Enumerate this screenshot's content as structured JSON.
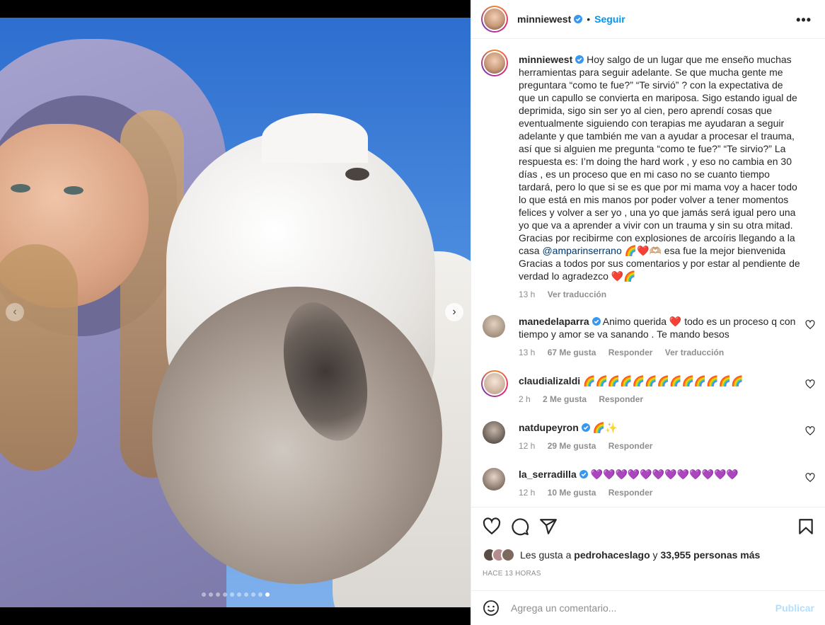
{
  "header": {
    "username": "minniewest",
    "separator": "•",
    "follow_label": "Seguir",
    "more_label": "•••"
  },
  "caption": {
    "username": "minniewest",
    "text_1": "Hoy salgo de un lugar que me enseño muchas herramientas para seguir adelante. Se que mucha gente me preguntara “como te fue?” “Te sirvió” ? con la expectativa de que un capullo se convierta en mariposa. Sigo estando igual de deprimida, sigo sin ser yo al cien, pero aprendí cosas que eventualmente siguiendo con terapias me ayudaran a seguir adelante y que también me van a ayudar a procesar el trauma, así que si alguien me pregunta “como te fue?” “Te sirvio?” La respuesta es: I’m doing the hard work , y eso no cambia en 30 días , es un proceso que en mi caso no se cuanto tiempo tardará, pero lo que si se es que por mi mama voy a hacer todo lo que está en mis manos por poder volver a tener momentos felices y volver a ser yo , una yo que jamás será igual pero una yo que va a aprender a vivir con un trauma y sin su otra mitad. Gracias por recibirme con explosiones de arcoíris llegando a la casa ",
    "mention": "@amparinserrano",
    "text_2": " 🌈❤️🫶🏼 esa fue la mejor bienvenida\nGracias a todos por sus comentarios y por estar al pendiente de verdad lo agradezco ❤️🌈",
    "time": "13 h",
    "translate": "Ver traducción"
  },
  "comments": [
    {
      "username": "manedelaparra",
      "text": "Animo querida ❤️ todo es un proceso q con tiempo y amor se va sanando . Te mando besos",
      "time": "13 h",
      "likes": "67 Me gusta",
      "reply": "Responder",
      "translate": "Ver traducción"
    },
    {
      "username": "claudializaldi",
      "text": "🌈🌈🌈🌈🌈🌈🌈🌈🌈🌈🌈🌈🌈",
      "time": "2 h",
      "likes": "2 Me gusta",
      "reply": "Responder"
    },
    {
      "username": "natdupeyron",
      "text": "🌈✨",
      "time": "12 h",
      "likes": "29 Me gusta",
      "reply": "Responder"
    },
    {
      "username": "la_serradilla",
      "text": "💜💜💜💜💜💜💜💜💜💜💜💜",
      "time": "12 h",
      "likes": "10 Me gusta",
      "reply": "Responder"
    }
  ],
  "likes": {
    "prefix": "Les gusta a ",
    "user": "pedrohaceslago",
    "mid": " y ",
    "count": "33,955 personas más"
  },
  "timestamp": "HACE 13 HORAS",
  "add_comment": {
    "placeholder": "Agrega un comentario...",
    "publish_label": "Publicar"
  },
  "carousel": {
    "prev_label": "‹",
    "next_label": "›",
    "slide_count": 10,
    "active_slide": 9
  },
  "colors": {
    "follow": "#0095f6",
    "verified": "#3897f0",
    "publish_disabled": "#b2dffc"
  },
  "icons": [
    "more-options-icon",
    "heart-icon",
    "comment-icon",
    "share-icon",
    "bookmark-icon",
    "emoji-icon",
    "verified-badge-icon"
  ]
}
